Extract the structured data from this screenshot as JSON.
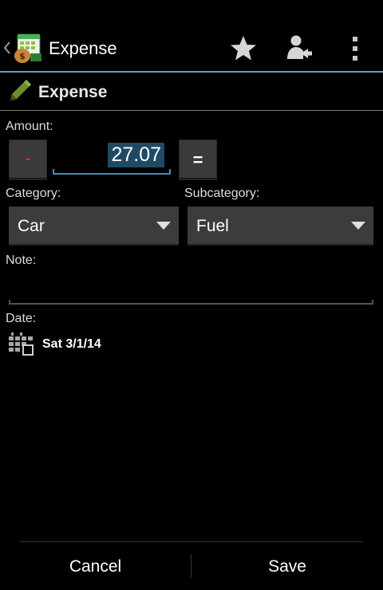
{
  "actionbar": {
    "title": "Expense",
    "icons": [
      "app-icon",
      "star-icon",
      "person-icon",
      "overflow-icon"
    ]
  },
  "section": {
    "title": "Expense"
  },
  "form": {
    "amount_label": "Amount:",
    "minus_label": "-",
    "amount_value": "27.07",
    "equals_label": "=",
    "category_label": "Category:",
    "category_value": "Car",
    "subcategory_label": "Subcategory:",
    "subcategory_value": "Fuel",
    "note_label": "Note:",
    "note_value": "",
    "date_label": "Date:",
    "date_value": "Sat 3/1/14"
  },
  "footer": {
    "cancel_label": "Cancel",
    "save_label": "Save"
  },
  "colors": {
    "accent": "#5aa6c8",
    "amount_highlight": "#1f4a63",
    "minus": "#c0392b"
  }
}
